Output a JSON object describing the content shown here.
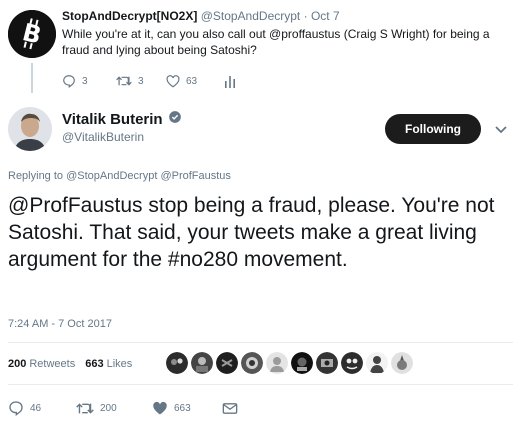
{
  "parent_tweet": {
    "name": "StopAndDecrypt[NO2X]",
    "handle": "@StopAndDecrypt",
    "separator": "·",
    "date": "Oct 7",
    "text": "While you're at it, can you also call out @proffaustus (Craig S Wright) for being a fraud and lying about being Satoshi?",
    "avatar_icon": "bitcoin-logo-icon",
    "actions": {
      "replies": "3",
      "retweets": "3",
      "likes": "63"
    }
  },
  "author": {
    "name": "Vitalik Buterin",
    "handle": "@VitalikButerin",
    "follow_label": "Following",
    "verified": true
  },
  "reply_to": {
    "prefix": "Replying to",
    "mentions": [
      "@StopAndDecrypt",
      "@ProfFaustus"
    ]
  },
  "tweet": {
    "text": "@ProfFaustus stop being a fraud, please. You're not Satoshi. That said, your tweets make a great living argument for the #no280 movement.",
    "timestamp": "7:24 AM - 7 Oct 2017"
  },
  "stats": {
    "retweets_count": "200",
    "retweets_label": "Retweets",
    "likes_count": "663",
    "likes_label": "Likes"
  },
  "actions": {
    "replies": "46",
    "retweets": "200",
    "likes": "663"
  },
  "colors": {
    "secondary_text": "#657786",
    "primary_text": "#14171a",
    "button_bg": "#1c1c1c",
    "divider": "#e6ecf0"
  }
}
